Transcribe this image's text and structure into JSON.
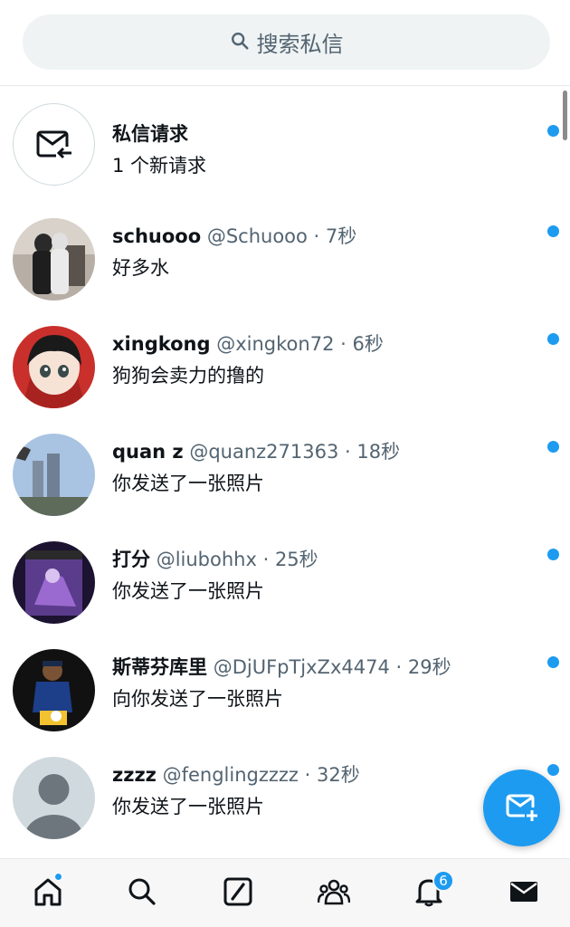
{
  "search": {
    "label": "搜索私信"
  },
  "request": {
    "title": "私信请求",
    "subtitle": "1 个新请求"
  },
  "conversations": [
    {
      "name": "schuooo",
      "handle": "@Schuooo",
      "time": "7秒",
      "preview": "好多水"
    },
    {
      "name": "xingkong",
      "handle": "@xingkon72",
      "time": "6秒",
      "preview": "狗狗会卖力的撸的"
    },
    {
      "name": "quan z",
      "handle": "@quanz271363",
      "time": "18秒",
      "preview": "你发送了一张照片"
    },
    {
      "name": "打分",
      "handle": "@liubohhx",
      "time": "25秒",
      "preview": "你发送了一张照片"
    },
    {
      "name": "斯蒂芬库里",
      "handle": "@DjUFpTjxZx4474",
      "time": "29秒",
      "preview": "向你发送了一张照片"
    },
    {
      "name": "zzzz",
      "handle": "@fenglingzzzz",
      "time": "32秒",
      "preview": "你发送了一张照片"
    }
  ],
  "separator": " · ",
  "tabbar": {
    "notification_count": "6"
  },
  "colors": {
    "accent": "#1d9bf0",
    "secondary_text": "#536471",
    "primary_text": "#0f1419"
  },
  "icons": [
    "search-icon",
    "mail-request-icon",
    "new-message-icon",
    "home-icon",
    "explore-icon",
    "grok-icon",
    "communities-icon",
    "notifications-icon",
    "messages-icon"
  ]
}
